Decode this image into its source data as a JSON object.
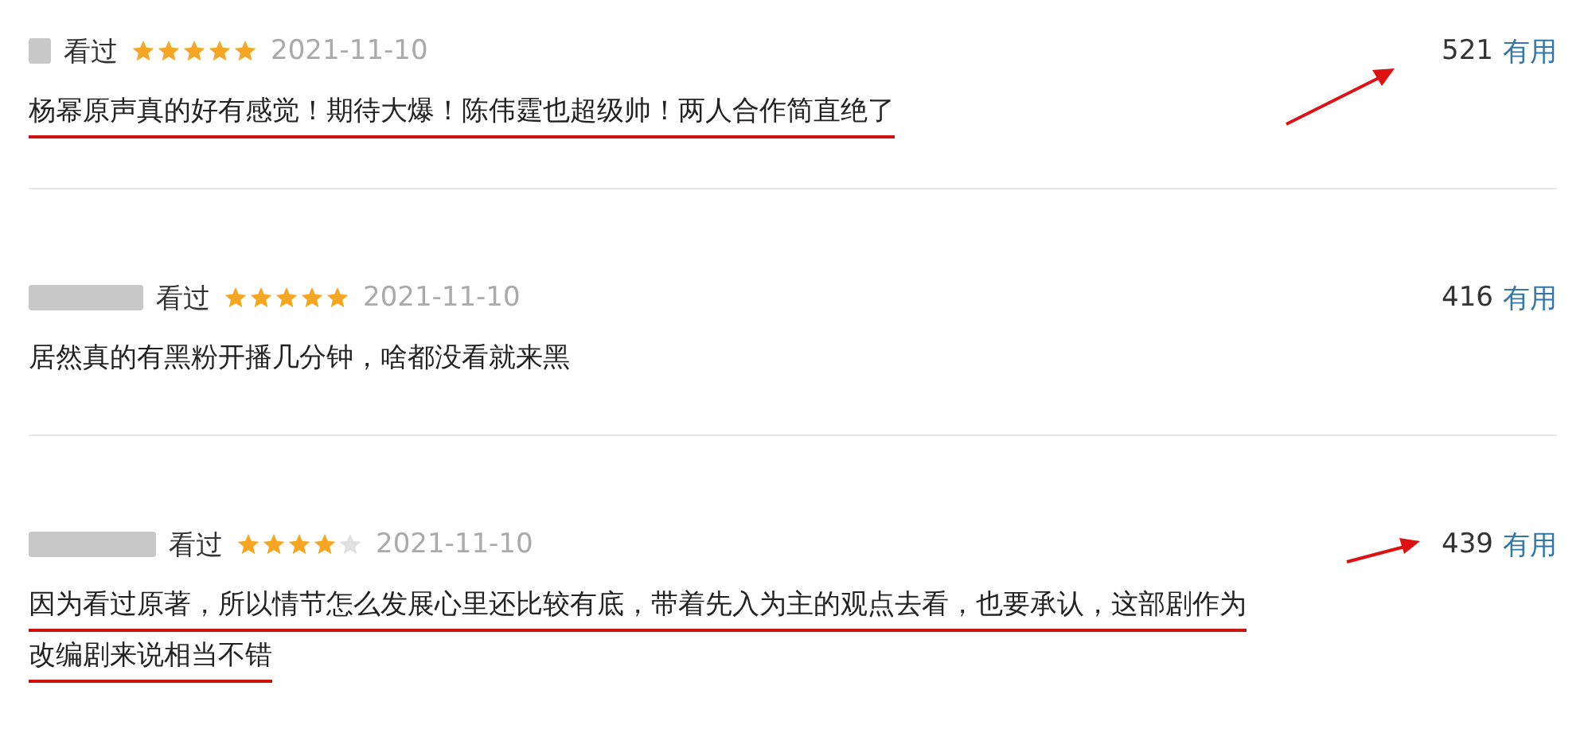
{
  "comments": [
    {
      "status": "看过",
      "stars": 5,
      "date": "2021-11-10",
      "votes": "521",
      "vote_label": "有用",
      "text": "杨幂原声真的好有感觉！期待大爆！陈伟霆也超级帅！两人合作简直绝了",
      "underlined": true,
      "arrow": {
        "kind": "long"
      }
    },
    {
      "status": "看过",
      "stars": 5,
      "date": "2021-11-10",
      "votes": "416",
      "vote_label": "有用",
      "text": "居然真的有黑粉开播几分钟，啥都没看就来黑",
      "underlined": false
    },
    {
      "status": "看过",
      "stars": 4,
      "date": "2021-11-10",
      "votes": "439",
      "vote_label": "有用",
      "text": "因为看过原著，所以情节怎么发展心里还比较有底，带着先入为主的观点去看，也要承认，这部剧作为改编剧来说相当不错",
      "underlined": true,
      "arrow": {
        "kind": "short"
      }
    }
  ]
}
